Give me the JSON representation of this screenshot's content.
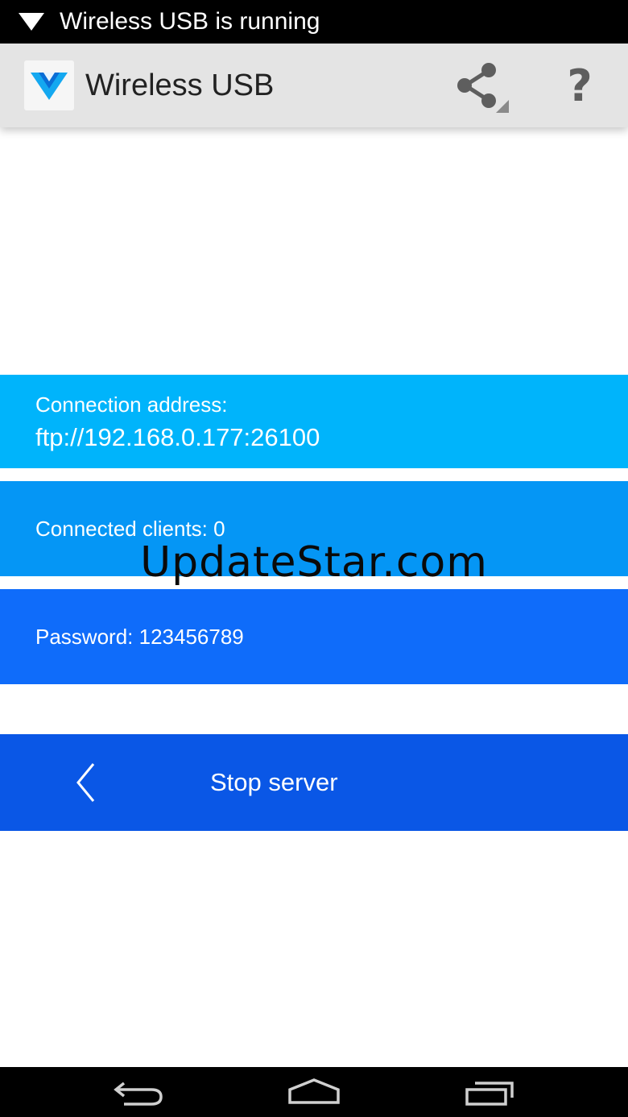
{
  "status_bar": {
    "notification_icon": "wifi-triangle-icon",
    "text": "Wireless USB is running"
  },
  "action_bar": {
    "app_icon": "wireless-usb-logo-icon",
    "title": "Wireless USB",
    "share_icon": "share-icon",
    "help_label": "?"
  },
  "connection": {
    "address_label": "Connection address:",
    "address_value": "ftp://192.168.0.177:26100",
    "clients_label": "Connected clients: 0",
    "password_label": "Password: 123456789"
  },
  "stop_button": {
    "icon": "chevron-left-icon",
    "label": "Stop server"
  },
  "watermark": "UpdateStar.com",
  "nav_bar": {
    "back_icon": "back-arrow-icon",
    "home_icon": "home-icon",
    "recents_icon": "recent-apps-icon"
  },
  "colors": {
    "address_panel": "#00b4fb",
    "clients_panel": "#0596f5",
    "password_panel": "#0f6cfa",
    "stop_button": "#0a57e6",
    "action_bar": "#e4e4e4"
  }
}
